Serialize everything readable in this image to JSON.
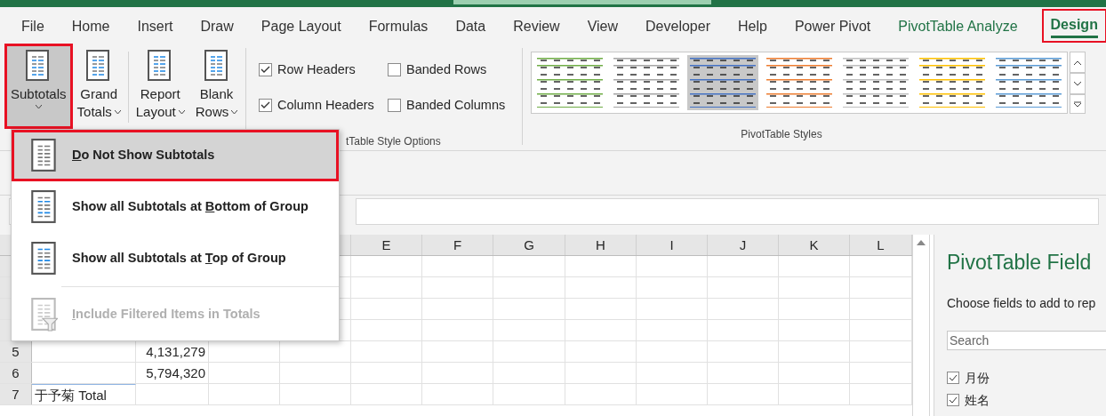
{
  "tabs": [
    {
      "label": "File",
      "selected": false,
      "contextual": false
    },
    {
      "label": "Home",
      "selected": false,
      "contextual": false
    },
    {
      "label": "Insert",
      "selected": false,
      "contextual": false
    },
    {
      "label": "Draw",
      "selected": false,
      "contextual": false
    },
    {
      "label": "Page Layout",
      "selected": false,
      "contextual": false
    },
    {
      "label": "Formulas",
      "selected": false,
      "contextual": false
    },
    {
      "label": "Data",
      "selected": false,
      "contextual": false
    },
    {
      "label": "Review",
      "selected": false,
      "contextual": false
    },
    {
      "label": "View",
      "selected": false,
      "contextual": false
    },
    {
      "label": "Developer",
      "selected": false,
      "contextual": false
    },
    {
      "label": "Help",
      "selected": false,
      "contextual": false
    },
    {
      "label": "Power Pivot",
      "selected": false,
      "contextual": false
    },
    {
      "label": "PivotTable Analyze",
      "selected": false,
      "contextual": true
    },
    {
      "label": "Design",
      "selected": true,
      "contextual": true
    }
  ],
  "layout_buttons": [
    {
      "lines": [
        "Subtotals"
      ],
      "selected": true,
      "kind": "subtotals"
    },
    {
      "lines": [
        "Grand",
        "Totals"
      ],
      "selected": false,
      "kind": "grand"
    },
    {
      "lines": [
        "Report",
        "Layout"
      ],
      "selected": false,
      "kind": "report"
    },
    {
      "lines": [
        "Blank",
        "Rows"
      ],
      "selected": false,
      "kind": "blank"
    }
  ],
  "style_options": {
    "label": "tTable Style Options",
    "checkboxes": [
      {
        "label": "Row Headers",
        "checked": true
      },
      {
        "label": "Banded Rows",
        "checked": false
      },
      {
        "label": "Column Headers",
        "checked": true
      },
      {
        "label": "Banded Columns",
        "checked": false
      }
    ]
  },
  "styles": {
    "label": "PivotTable Styles",
    "thumbnails": [
      {
        "color": "#70ad47",
        "selected": false
      },
      {
        "color": "#a5a5a5",
        "selected": false
      },
      {
        "color": "#4472c4",
        "selected": true
      },
      {
        "color": "#ed7d31",
        "selected": false
      },
      {
        "color": "#bfbfbf",
        "selected": false
      },
      {
        "color": "#ffc000",
        "selected": false
      },
      {
        "color": "#5b9bd5",
        "selected": false
      }
    ]
  },
  "subtotals_menu": [
    {
      "key": "D",
      "post": "o Not Show Subtotals",
      "kind": "none",
      "selected": true,
      "disabled": false
    },
    {
      "pre": "Show all Subtotals at ",
      "key": "B",
      "post": "ottom of Group",
      "kind": "bottom",
      "selected": false,
      "disabled": false
    },
    {
      "pre": "Show all Subtotals at ",
      "key": "T",
      "post": "op of Group",
      "kind": "top",
      "selected": false,
      "disabled": false
    },
    {
      "key": "I",
      "post": "nclude Filtered Items in Totals",
      "kind": "filter",
      "selected": false,
      "disabled": true
    }
  ],
  "sheet": {
    "columns": [
      "E",
      "F",
      "G",
      "H",
      "I",
      "J",
      "K",
      "L"
    ],
    "rows": [
      {
        "number": "5",
        "cells": [
          "",
          "4,131,279"
        ]
      },
      {
        "number": "6",
        "cells": [
          "",
          "5,794,320"
        ]
      },
      {
        "number": "7",
        "cells": [
          "于予菊 Total",
          ""
        ]
      }
    ]
  },
  "field_pane": {
    "title": "PivotTable Field",
    "hint": "Choose fields to add to rep",
    "search": {
      "placeholder": "Search"
    },
    "fields": [
      {
        "label": "月份",
        "checked": true
      },
      {
        "label": "姓名",
        "checked": true
      }
    ]
  }
}
